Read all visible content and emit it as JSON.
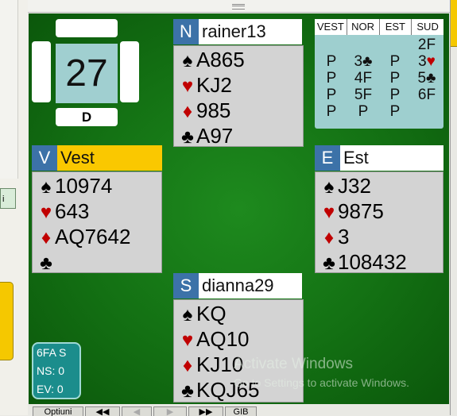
{
  "board": {
    "number": "27",
    "dealer": "D"
  },
  "north": {
    "dir": "N",
    "name": "rainer13",
    "spades": "A865",
    "hearts": "KJ2",
    "diamonds": "985",
    "clubs": "A97"
  },
  "west": {
    "dir": "V",
    "name": "Vest",
    "spades": "10974",
    "hearts": "643",
    "diamonds": "AQ7642",
    "clubs": ""
  },
  "east": {
    "dir": "E",
    "name": "Est",
    "spades": "J32",
    "hearts": "9875",
    "diamonds": "3",
    "clubs": "108432"
  },
  "south": {
    "dir": "S",
    "name": "dianna29",
    "spades": "KQ",
    "hearts": "AQ10",
    "diamonds": "KJ10",
    "clubs": "KQJ65"
  },
  "bidding": {
    "headers": [
      "VEST",
      "NOR",
      "EST",
      "SUD"
    ],
    "rows": [
      [
        "",
        "",
        "",
        "2F"
      ],
      [
        "P",
        "3♣",
        "P",
        "3♥"
      ],
      [
        "P",
        "4F",
        "P",
        "5♣"
      ],
      [
        "P",
        "5F",
        "P",
        "6F"
      ],
      [
        "P",
        "P",
        "P",
        ""
      ]
    ]
  },
  "score": {
    "contract": "6FA S",
    "ns": "NS: 0",
    "ev": "EV: 0"
  },
  "suits": {
    "spade": "♠",
    "heart": "♥",
    "diamond": "♦",
    "club": "♣"
  },
  "bottom_bar": {
    "options_label": "Optiuni",
    "first": "◀◀",
    "prev": "◀",
    "next": "▶",
    "last": "▶▶",
    "gib": "GIB"
  },
  "left_panel": {
    "label": "i"
  },
  "watermark": {
    "line1": "Activate Windows",
    "line2": "Go to Settings to activate Windows."
  },
  "colors": {
    "felt": "#137013",
    "dir_badge": "#3c72a8",
    "active_player": "#fac800",
    "bid_box": "#9ecfcf",
    "hearts_diamonds": "#c00000"
  }
}
